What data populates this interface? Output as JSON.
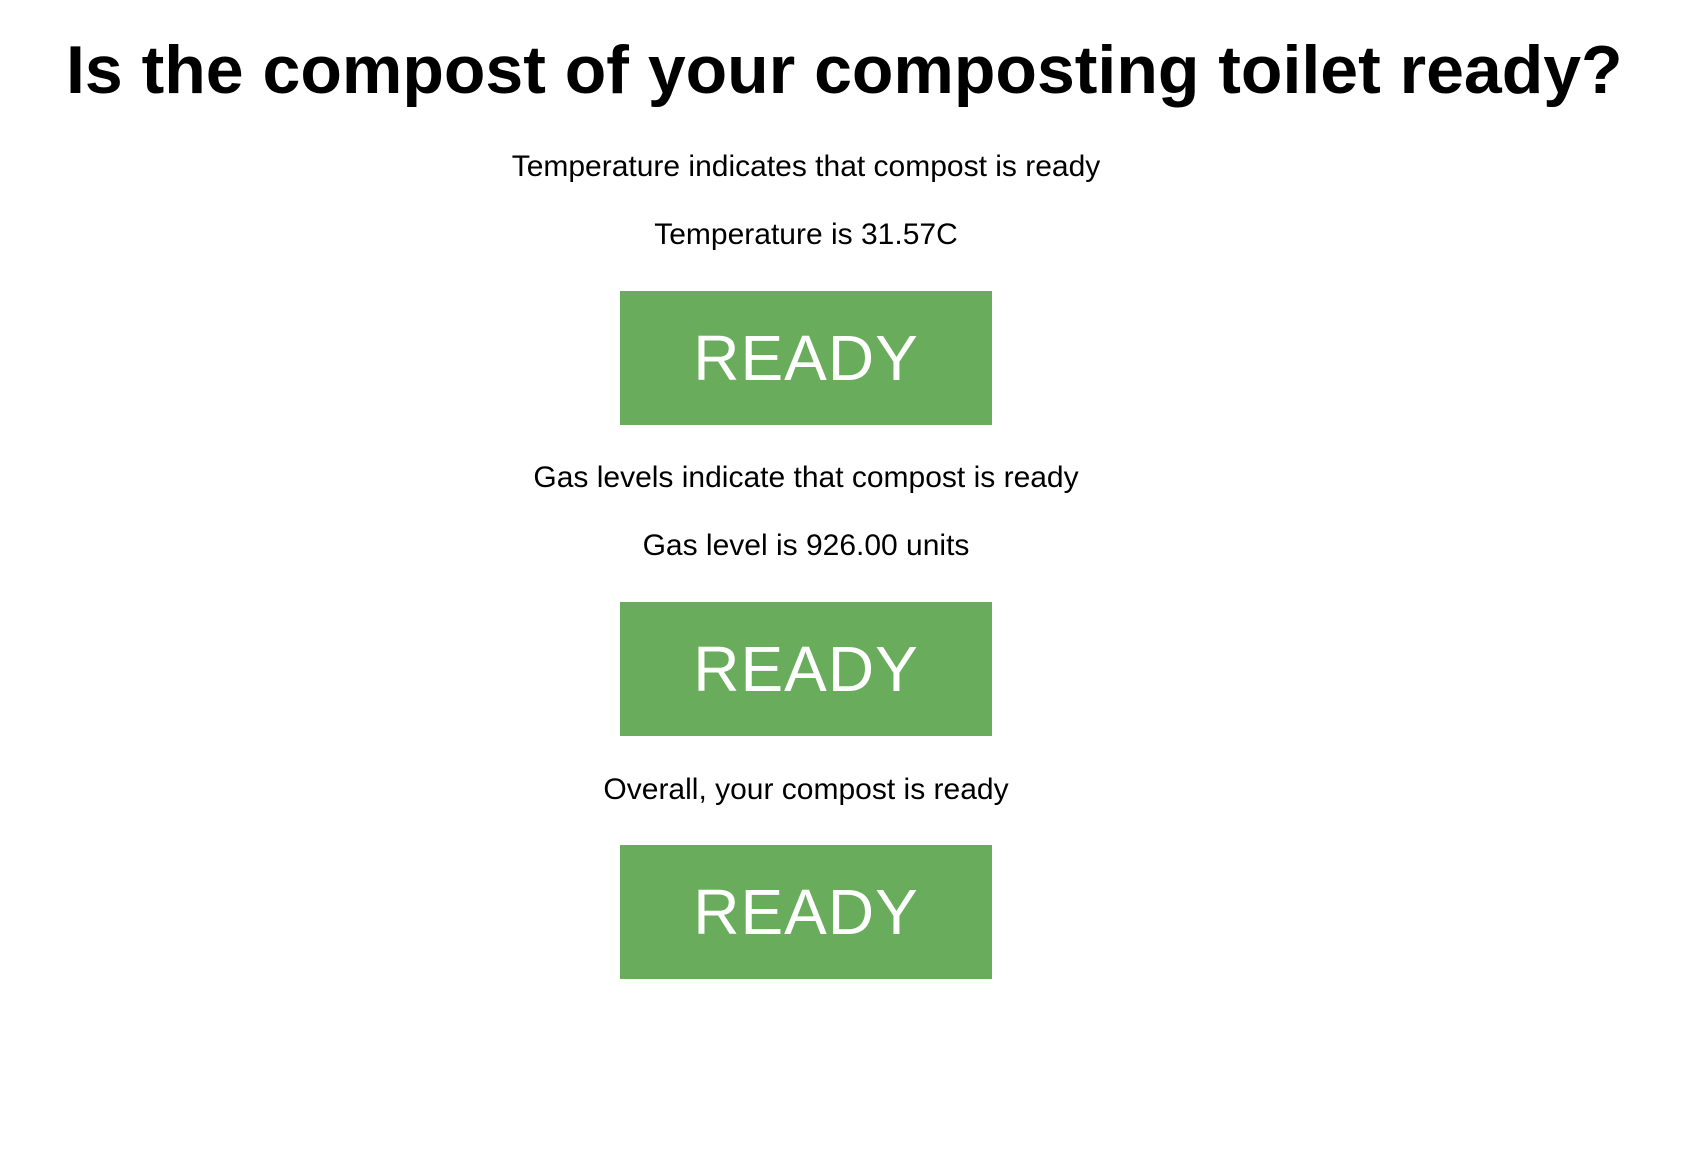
{
  "page": {
    "title": "Is the compost of your composting toilet ready?"
  },
  "temperature": {
    "message": "Temperature indicates that compost is ready",
    "reading": "Temperature is 31.57C",
    "status_label": "READY"
  },
  "gas": {
    "message": "Gas levels indicate that compost is ready",
    "reading": "Gas level is 926.00 units",
    "status_label": "READY"
  },
  "overall": {
    "message": "Overall, your compost is ready",
    "status_label": "READY"
  },
  "colors": {
    "ready_badge_bg": "#69ad5c",
    "ready_badge_text": "#ffffff"
  }
}
